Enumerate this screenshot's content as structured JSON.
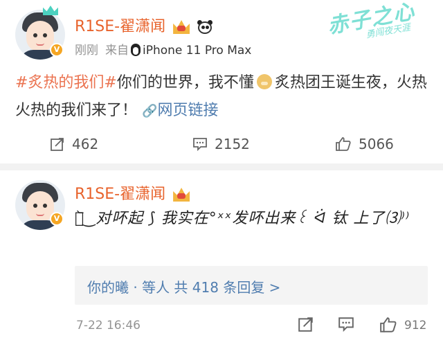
{
  "post": {
    "username": "R1SE-翟潇闻",
    "meta": {
      "time": "刚刚",
      "source_prefix": "来自",
      "device": "iPhone 11 Pro Max"
    },
    "text": {
      "topic": "#炙热的我们#",
      "part1": "你们的世界，我不懂",
      "part2": "炙热团王诞生夜，火热火热的我们来了！",
      "link_label": "网页链接"
    },
    "actions": {
      "repost_count": "462",
      "comment_count": "2152",
      "like_count": "5066"
    }
  },
  "comment": {
    "username": "R1SE-翟潇闻",
    "text": "⌒᷅ ͜ 对吥起 ⟆ 我实在°ˣˣ发吥出来꒰ ᐛ 钛 上了⑶⁾⁾",
    "reply_summary": "你的曦 · 等人 共 418 条回复 >",
    "timestamp": "7-22 16:46",
    "like_count": "912"
  },
  "colors": {
    "username": "#e8632c",
    "topic": "#eb7350",
    "link": "#507daf",
    "muted": "#939393"
  },
  "icons": [
    "repost-icon",
    "comment-icon",
    "like-icon",
    "link-icon",
    "penguin-icon",
    "verified-badge-icon",
    "crown-badge-icon",
    "panda-badge-icon",
    "dog-emoji-icon"
  ]
}
